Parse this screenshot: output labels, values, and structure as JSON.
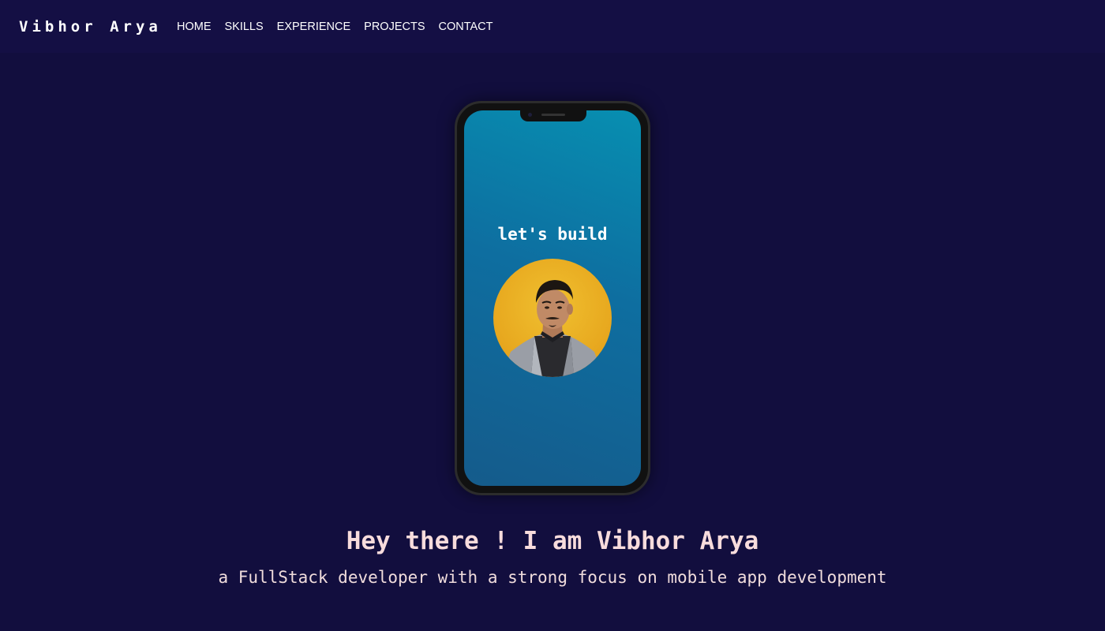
{
  "navbar": {
    "brand": "Vibhor Arya",
    "links": [
      {
        "label": "HOME"
      },
      {
        "label": "SKILLS"
      },
      {
        "label": "EXPERIENCE"
      },
      {
        "label": "PROJECTS"
      },
      {
        "label": "CONTACT"
      }
    ]
  },
  "hero": {
    "phone_text": "let's build",
    "headline": "Hey there ! I am Vibhor Arya",
    "tagline": "a FullStack developer with a strong focus on mobile app development"
  },
  "colors": {
    "background": "#130f40",
    "screen_gradient_top": "#078fb1",
    "screen_gradient_bottom": "#155b8b",
    "avatar_background": "#e8aa20",
    "headline_text": "#f8dcdc"
  }
}
